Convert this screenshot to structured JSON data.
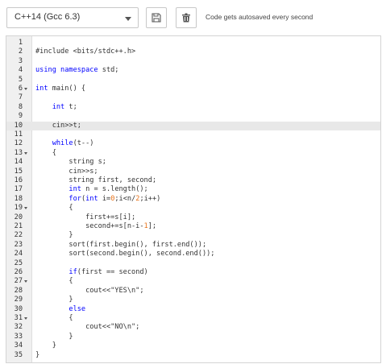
{
  "toolbar": {
    "language_label": "C++14 (Gcc 6.3)",
    "save_icon": "floppy-disk-icon",
    "delete_icon": "trash-icon",
    "autosave_note": "Code gets autosaved every second"
  },
  "editor": {
    "active_line": 10,
    "colors": {
      "keyword": "#0000ff",
      "number": "#e8731a",
      "text": "#333333"
    },
    "lines": [
      {
        "n": "1",
        "fold": false,
        "tokens": []
      },
      {
        "n": "2",
        "fold": false,
        "tokens": [
          [
            "pp",
            "#include <bits/stdc++.h>"
          ]
        ]
      },
      {
        "n": "3",
        "fold": false,
        "tokens": []
      },
      {
        "n": "4",
        "fold": false,
        "tokens": [
          [
            "kw",
            "using namespace"
          ],
          [
            "t",
            " std;"
          ]
        ]
      },
      {
        "n": "5",
        "fold": false,
        "tokens": []
      },
      {
        "n": "6",
        "fold": true,
        "tokens": [
          [
            "kw",
            "int"
          ],
          [
            "t",
            " main() {"
          ]
        ]
      },
      {
        "n": "7",
        "fold": false,
        "tokens": []
      },
      {
        "n": "8",
        "fold": false,
        "tokens": [
          [
            "t",
            "    "
          ],
          [
            "kw",
            "int"
          ],
          [
            "t",
            " t;"
          ]
        ]
      },
      {
        "n": "9",
        "fold": false,
        "tokens": []
      },
      {
        "n": "10",
        "fold": false,
        "tokens": [
          [
            "t",
            "    cin>>t;"
          ]
        ]
      },
      {
        "n": "11",
        "fold": false,
        "tokens": []
      },
      {
        "n": "12",
        "fold": false,
        "tokens": [
          [
            "t",
            "    "
          ],
          [
            "kw",
            "while"
          ],
          [
            "t",
            "(t--)"
          ]
        ]
      },
      {
        "n": "13",
        "fold": true,
        "tokens": [
          [
            "t",
            "    {"
          ]
        ]
      },
      {
        "n": "14",
        "fold": false,
        "tokens": [
          [
            "t",
            "        string s;"
          ]
        ]
      },
      {
        "n": "15",
        "fold": false,
        "tokens": [
          [
            "t",
            "        cin>>s;"
          ]
        ]
      },
      {
        "n": "16",
        "fold": false,
        "tokens": [
          [
            "t",
            "        string first, second;"
          ]
        ]
      },
      {
        "n": "17",
        "fold": false,
        "tokens": [
          [
            "t",
            "        "
          ],
          [
            "kw",
            "int"
          ],
          [
            "t",
            " n = s.length();"
          ]
        ]
      },
      {
        "n": "18",
        "fold": false,
        "tokens": [
          [
            "t",
            "        "
          ],
          [
            "kw",
            "for"
          ],
          [
            "t",
            "("
          ],
          [
            "kw",
            "int"
          ],
          [
            "t",
            " i="
          ],
          [
            "num",
            "0"
          ],
          [
            "t",
            ";i<n/"
          ],
          [
            "num",
            "2"
          ],
          [
            "t",
            ";i++)"
          ]
        ]
      },
      {
        "n": "19",
        "fold": true,
        "tokens": [
          [
            "t",
            "        {"
          ]
        ]
      },
      {
        "n": "20",
        "fold": false,
        "tokens": [
          [
            "t",
            "            first+=s[i];"
          ]
        ]
      },
      {
        "n": "21",
        "fold": false,
        "tokens": [
          [
            "t",
            "            second+=s[n-i-"
          ],
          [
            "num",
            "1"
          ],
          [
            "t",
            "];"
          ]
        ]
      },
      {
        "n": "22",
        "fold": false,
        "tokens": [
          [
            "t",
            "        }"
          ]
        ]
      },
      {
        "n": "23",
        "fold": false,
        "tokens": [
          [
            "t",
            "        sort(first.begin(), first.end());"
          ]
        ]
      },
      {
        "n": "24",
        "fold": false,
        "tokens": [
          [
            "t",
            "        sort(second.begin(), second.end());"
          ]
        ]
      },
      {
        "n": "25",
        "fold": false,
        "tokens": []
      },
      {
        "n": "26",
        "fold": false,
        "tokens": [
          [
            "t",
            "        "
          ],
          [
            "kw",
            "if"
          ],
          [
            "t",
            "(first == second)"
          ]
        ]
      },
      {
        "n": "27",
        "fold": true,
        "tokens": [
          [
            "t",
            "        {"
          ]
        ]
      },
      {
        "n": "28",
        "fold": false,
        "tokens": [
          [
            "t",
            "            cout<<\"YES\\n\";"
          ]
        ]
      },
      {
        "n": "29",
        "fold": false,
        "tokens": [
          [
            "t",
            "        }"
          ]
        ]
      },
      {
        "n": "30",
        "fold": false,
        "tokens": [
          [
            "t",
            "        "
          ],
          [
            "kw",
            "else"
          ]
        ]
      },
      {
        "n": "31",
        "fold": true,
        "tokens": [
          [
            "t",
            "        {"
          ]
        ]
      },
      {
        "n": "32",
        "fold": false,
        "tokens": [
          [
            "t",
            "            cout<<\"NO\\n\";"
          ]
        ]
      },
      {
        "n": "33",
        "fold": false,
        "tokens": [
          [
            "t",
            "        }"
          ]
        ]
      },
      {
        "n": "34",
        "fold": false,
        "tokens": [
          [
            "t",
            "    }"
          ]
        ]
      },
      {
        "n": "35",
        "fold": false,
        "tokens": [
          [
            "t",
            "}"
          ]
        ]
      }
    ]
  }
}
